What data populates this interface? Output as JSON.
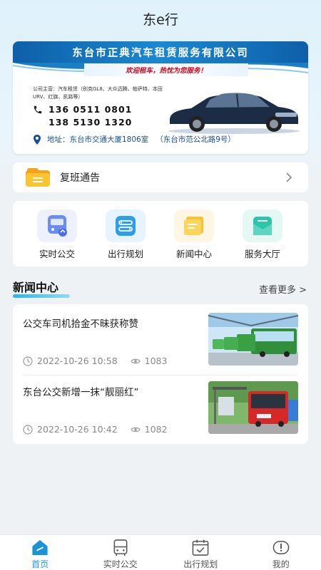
{
  "app": {
    "title": "东e行"
  },
  "banner": {
    "company": "东台市正典汽车租赁服务有限公司",
    "slogan": "欢迎租车，热忱为您服务！",
    "scope": "公司主营：汽车租赁（别克GL8、大众迈腾、帕萨特、本田URV、红旗、凯路等）",
    "phone1": "136 0511 0801",
    "phone2": "138 5130 1320",
    "address": "地址：东台市交通大厦1806室",
    "address_extra": "（东台市范公北路9号）"
  },
  "notice": {
    "label": "复班通告"
  },
  "menu": {
    "items": [
      {
        "label": "实时公交",
        "icon": "bus-icon",
        "color": "#6a8cf0"
      },
      {
        "label": "出行规划",
        "icon": "route-icon",
        "color": "#2f9ee8"
      },
      {
        "label": "新闻中心",
        "icon": "news-icon",
        "color": "#f5c23a"
      },
      {
        "label": "服务大厅",
        "icon": "service-hall-icon",
        "color": "#2ec4a8"
      }
    ]
  },
  "news": {
    "title": "新闻中心",
    "more": "查看更多 >",
    "items": [
      {
        "headline": "公交车司机拾金不昧获称赞",
        "date": "2022-10-26 10:58",
        "views": "1083"
      },
      {
        "headline": "东台公交新增一抹“靓丽红”",
        "date": "2022-10-26 10:42",
        "views": "1082"
      }
    ]
  },
  "tabbar": {
    "items": [
      {
        "label": "首页",
        "icon": "home-icon",
        "active": true
      },
      {
        "label": "实时公交",
        "icon": "bus-icon",
        "active": false
      },
      {
        "label": "出行规划",
        "icon": "calendar-check-icon",
        "active": false
      },
      {
        "label": "我的",
        "icon": "profile-icon",
        "active": false
      }
    ]
  },
  "colors": {
    "accent": "#1a94d6",
    "page_bg": "#eef2f5",
    "banner_blue": "#0e5fa8"
  }
}
